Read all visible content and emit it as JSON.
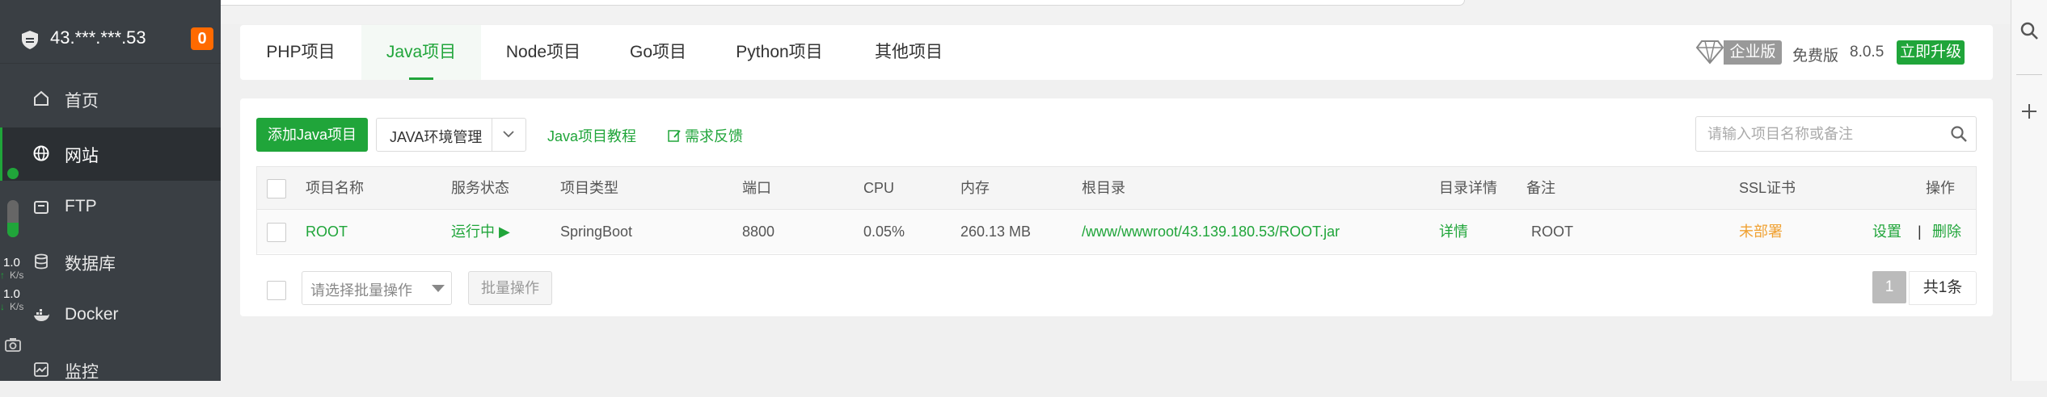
{
  "sidebar": {
    "server_ip": "43.***.***.53",
    "badge_count": "0",
    "items": [
      {
        "label": "首页",
        "icon": "home-icon"
      },
      {
        "label": "网站",
        "icon": "globe-icon",
        "active": true
      },
      {
        "label": "FTP",
        "icon": "ftp-icon"
      },
      {
        "label": "数据库",
        "icon": "database-icon"
      },
      {
        "label": "Docker",
        "icon": "docker-icon"
      },
      {
        "label": "监控",
        "icon": "monitor-icon"
      }
    ],
    "network": {
      "up_rate": "1.0",
      "up_unit": "K/s",
      "down_rate": "1.0",
      "down_unit": "K/s"
    },
    "accent_color": "#20a53a"
  },
  "tabs": [
    {
      "label": "PHP项目",
      "active": false
    },
    {
      "label": "Java项目",
      "active": true
    },
    {
      "label": "Node项目",
      "active": false
    },
    {
      "label": "Go项目",
      "active": false
    },
    {
      "label": "Python项目",
      "active": false
    },
    {
      "label": "其他项目",
      "active": false
    }
  ],
  "version_info": {
    "edition": "企业版",
    "free_label": "免费版",
    "version": "8.0.5",
    "upgrade_label": "立即升级"
  },
  "toolbar": {
    "add_button": "添加Java项目",
    "env_button": "JAVA环境管理",
    "tutorial_link": "Java项目教程",
    "feedback_link": "需求反馈",
    "search_placeholder": "请输入项目名称或备注"
  },
  "table": {
    "headers": [
      "项目名称",
      "服务状态",
      "项目类型",
      "端口",
      "CPU",
      "内存",
      "根目录",
      "目录详情",
      "备注",
      "SSL证书",
      "操作"
    ],
    "rows": [
      {
        "name": "ROOT",
        "status": "运行中 ▶",
        "type": "SpringBoot",
        "port": "8800",
        "cpu": "0.05%",
        "memory": "260.13 MB",
        "root": "/www/wwwroot/43.139.180.53/ROOT.jar",
        "details": "详情",
        "remark": "ROOT",
        "ssl": "未部署",
        "action_settings": "设置",
        "action_sep": "|",
        "action_delete": "删除"
      }
    ]
  },
  "footer": {
    "batch_placeholder": "请选择批量操作",
    "batch_button": "批量操作",
    "current_page": "1",
    "total": "共1条"
  }
}
